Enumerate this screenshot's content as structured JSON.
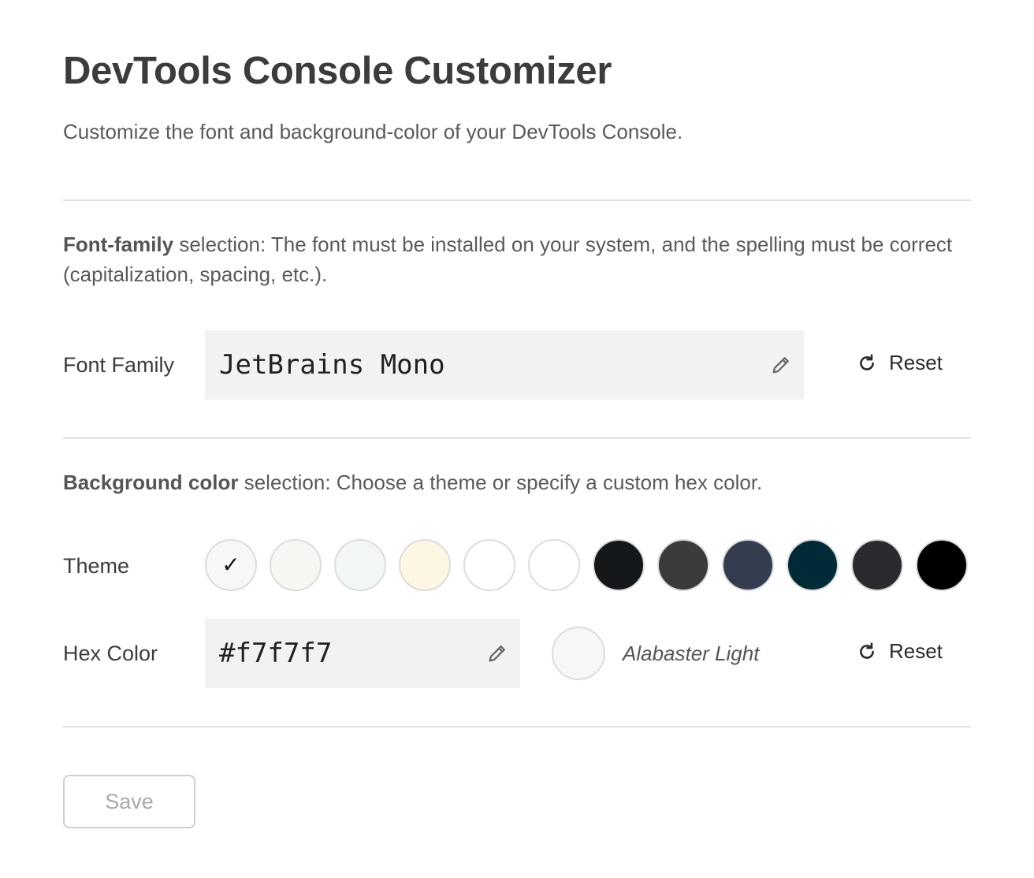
{
  "header": {
    "title": "DevTools Console Customizer",
    "subtitle": "Customize the font and background-color of your DevTools Console."
  },
  "font_section": {
    "desc_bold": "Font-family",
    "desc_rest": " selection: The font must be installed on your system, and the spelling must be correct (capitalization, spacing, etc.).",
    "label": "Font Family",
    "value": "JetBrains Mono",
    "reset_label": "Reset"
  },
  "bg_section": {
    "desc_bold": "Background color",
    "desc_rest": " selection: Choose a theme or specify a custom hex color.",
    "theme_label": "Theme",
    "themes": [
      {
        "color": "#f7f7f7",
        "selected": true
      },
      {
        "color": "#f7f6f2",
        "selected": false
      },
      {
        "color": "#f3f6f7",
        "selected": false
      },
      {
        "color": "#fdf6e3",
        "selected": false
      },
      {
        "color": "#ffffff",
        "selected": false
      },
      {
        "color": "#ffffff",
        "selected": false
      },
      {
        "color": "#14181b",
        "selected": false
      },
      {
        "color": "#3b3b3b",
        "selected": false
      },
      {
        "color": "#343d4f",
        "selected": false
      },
      {
        "color": "#002b36",
        "selected": false
      },
      {
        "color": "#2b2a2e",
        "selected": false
      },
      {
        "color": "#000000",
        "selected": false
      }
    ],
    "check_glyph": "✓",
    "hex_label": "Hex Color",
    "hex_value": "#f7f7f7",
    "theme_name": "Alabaster Light",
    "reset_label": "Reset"
  },
  "footer": {
    "save_label": "Save"
  },
  "icons": {
    "edit": "pencil-icon",
    "reset": "refresh-icon"
  }
}
